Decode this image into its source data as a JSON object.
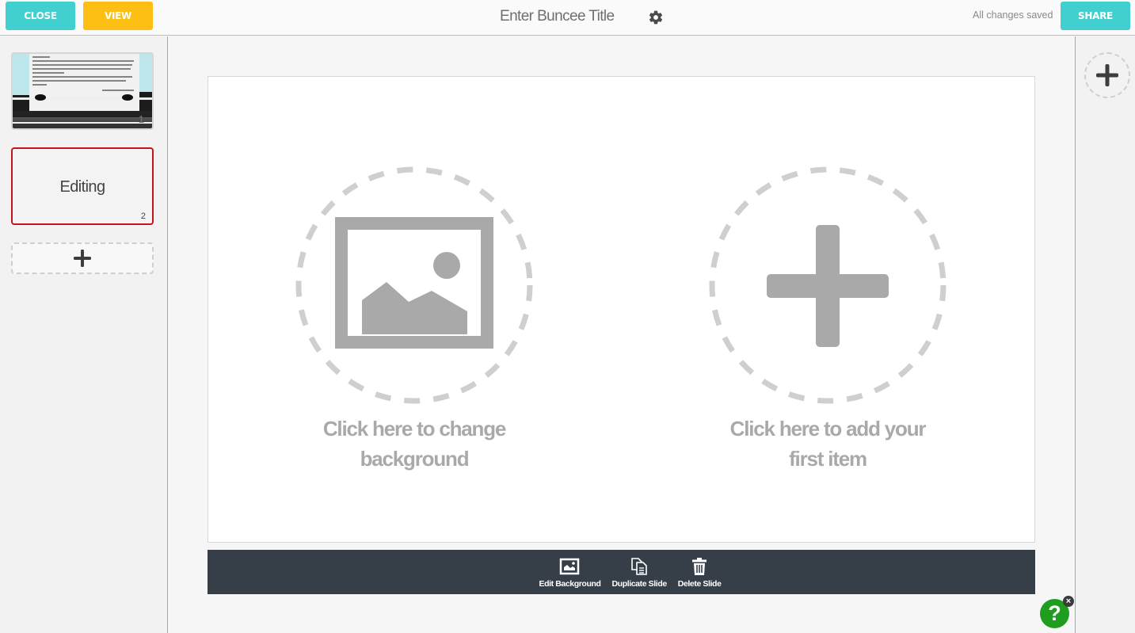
{
  "header": {
    "close_label": "CLOSE",
    "view_label": "VIEW",
    "title": "Enter Buncee Title",
    "settings_icon": "gear-icon",
    "save_status": "All changes saved",
    "share_label": "SHARE"
  },
  "sidebar": {
    "slides": [
      {
        "number": "1",
        "label": "",
        "selected": false
      },
      {
        "number": "2",
        "label": "Editing",
        "selected": true
      }
    ],
    "add_slide_icon": "plus-icon"
  },
  "right_panel": {
    "add_item_icon": "plus-icon"
  },
  "slide": {
    "background_prompt": "Click here to change background",
    "add_item_prompt": "Click here to add your first item"
  },
  "toolbar": {
    "items": [
      {
        "icon": "image-icon",
        "label": "Edit Background"
      },
      {
        "icon": "duplicate-icon",
        "label": "Duplicate Slide"
      },
      {
        "icon": "trash-icon",
        "label": "Delete Slide"
      }
    ]
  },
  "help": {
    "label": "?",
    "close_label": "×"
  },
  "colors": {
    "accent_teal": "#42cfd0",
    "accent_yellow": "#fdbf13",
    "selected_border": "#c0171c",
    "toolbar_bg": "#363f48",
    "help_green": "#1e9d1e"
  }
}
